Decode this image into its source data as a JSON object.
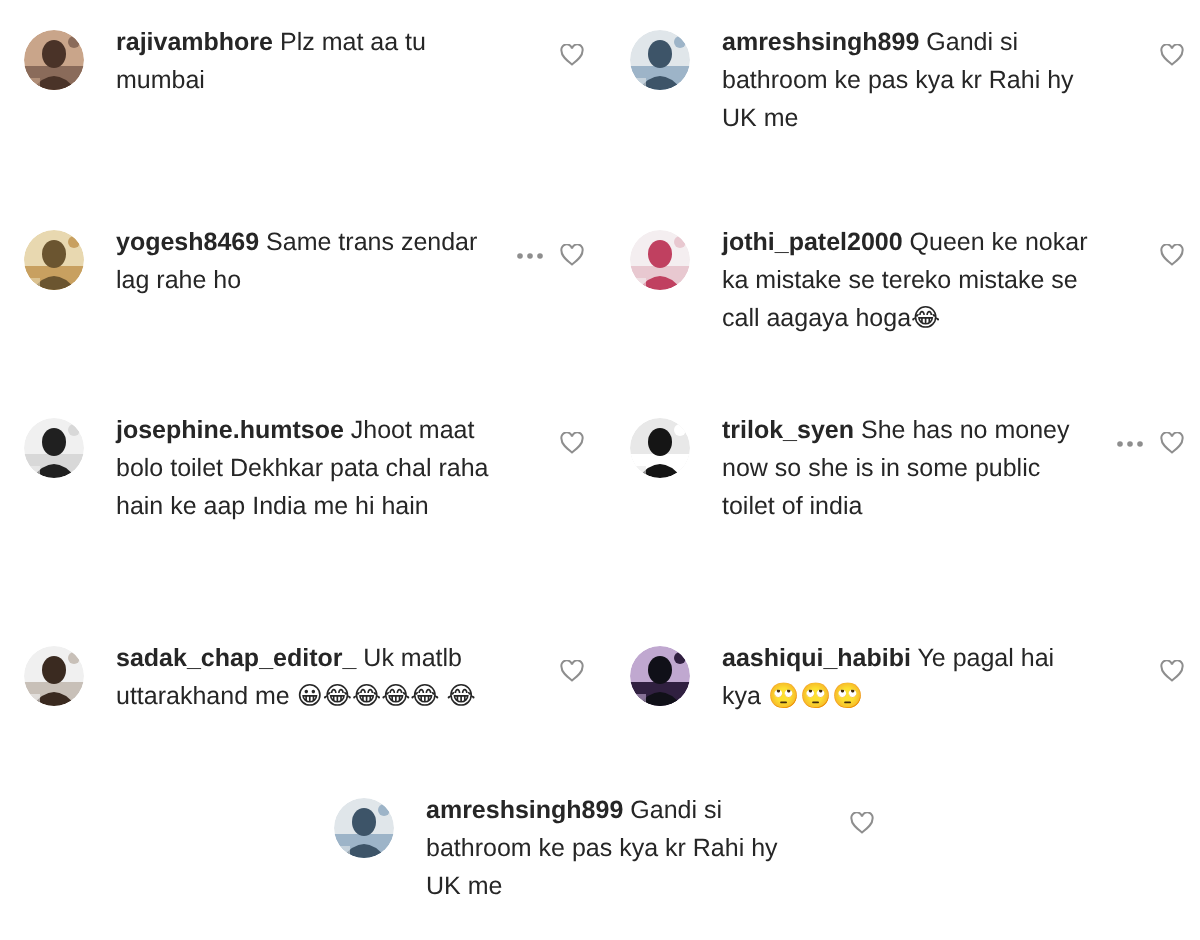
{
  "comments": [
    {
      "username": "rajivambhore",
      "text": "Plz mat aa tu mumbai",
      "more": false
    },
    {
      "username": "amreshsingh899",
      "text": "Gandi si bathroom ke pas kya kr Rahi hy UK me",
      "more": false
    },
    {
      "username": "yogesh8469",
      "text": "Same trans zendar lag rahe ho",
      "more": true
    },
    {
      "username": "jothi_patel2000",
      "text": "Queen ke nokar ka mistake se tereko mistake se call aagaya hoga😂",
      "more": false
    },
    {
      "username": "josephine.humtsoe",
      "text": "Jhoot maat bolo toilet Dekhkar pata chal raha hain ke aap India me hi hain",
      "more": false
    },
    {
      "username": "trilok_syen",
      "text": "She has no money now so she is in some public toilet of india",
      "more": true
    },
    {
      "username": "sadak_chap_editor_",
      "text": "Uk matlb uttarakhand me 😀😂😂😂😂 😂",
      "more": false
    },
    {
      "username": "aashiqui_habibi",
      "text": "Ye pagal hai kya 🙄🙄🙄",
      "more": false
    },
    {
      "username": "amreshsingh899",
      "text": "Gandi si bathroom ke pas kya kr Rahi hy UK me",
      "more": false
    }
  ]
}
